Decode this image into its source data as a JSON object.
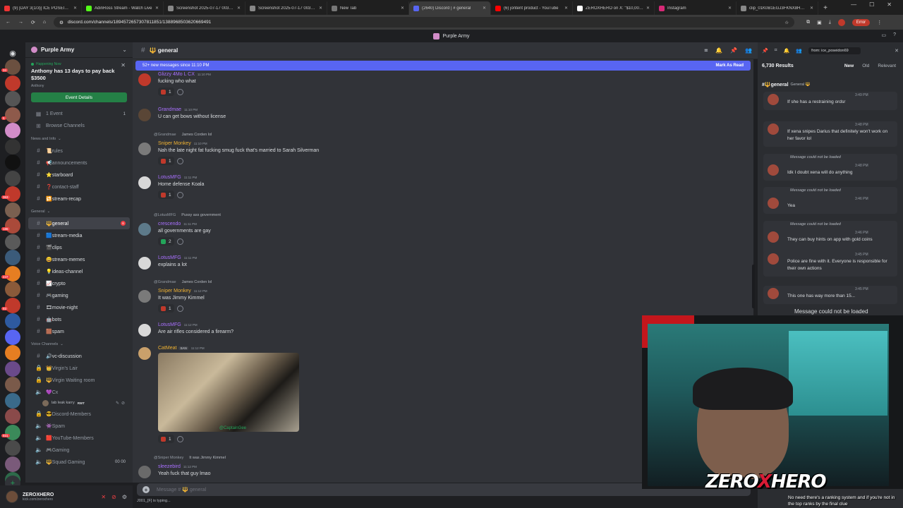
{
  "browser": {
    "tabs": [
      {
        "title": "(9) [DAY 3(1/3)] ICE POSEIDON",
        "color": "#e33"
      },
      {
        "title": "AdinRoss Stream - Watch Live",
        "color": "#53fc18"
      },
      {
        "title": "Screenshot 2025-07-17 003931",
        "color": "#888"
      },
      {
        "title": "Screenshot 2025-07-17 003938",
        "color": "#888"
      },
      {
        "title": "New Tab",
        "color": "#777"
      },
      {
        "title": "(2640) Discord | # general",
        "color": "#5865f2"
      },
      {
        "title": "(6) jontent product - YouTube",
        "color": "#f00"
      },
      {
        "title": "ZEROXHERO on X: \"$10,000 A...",
        "color": "#fff"
      },
      {
        "title": "Instagram",
        "color": "#d62976"
      },
      {
        "title": "clip_01K0B1EGJ3FKNX8HG7V...",
        "color": "#888"
      }
    ],
    "url": "discord.com/channels/1894572657307811851/1388968503620669491",
    "error_label": "Error"
  },
  "window": {
    "title": "Purple Army"
  },
  "server": {
    "name": "Purple Army"
  },
  "event": {
    "status": "Happening Now",
    "title": "Anthony has 13 days to pay back $3500",
    "host": "Anthony",
    "button": "Event Details"
  },
  "guild_badges": [
    "34",
    "",
    "",
    "5",
    "",
    "",
    "",
    "",
    "363",
    "",
    "186",
    "",
    "",
    "247",
    "",
    "93",
    "",
    "",
    "",
    "",
    "",
    "",
    "",
    "931",
    "",
    "",
    "",
    "483"
  ],
  "sidebar": {
    "top": [
      {
        "icon": "calendar",
        "label": "1 Event",
        "count": "1"
      },
      {
        "icon": "browse",
        "label": "Browse Channels",
        "count": ""
      }
    ],
    "categories": [
      {
        "name": "News and Info",
        "channels": [
          {
            "label": "📜rules",
            "type": "text"
          },
          {
            "label": "📢announcements",
            "type": "text"
          },
          {
            "label": "⭐starboard",
            "type": "text",
            "bright": true
          },
          {
            "label": "❓contact-staff",
            "type": "text"
          },
          {
            "label": "🔁stream-recap",
            "type": "text",
            "bright": true
          }
        ]
      },
      {
        "name": "General",
        "channels": [
          {
            "label": "🔱general",
            "type": "text",
            "selected": true,
            "unread": "6"
          },
          {
            "label": "🟦stream-media",
            "type": "text",
            "bright": true
          },
          {
            "label": "🎬clips",
            "type": "text",
            "bright": true
          },
          {
            "label": "😄stream-memes",
            "type": "text",
            "bright": true
          },
          {
            "label": "💡ideas-channel",
            "type": "text",
            "bright": true
          },
          {
            "label": "📈crypto",
            "type": "text",
            "bright": true
          },
          {
            "label": "🎮gaming",
            "type": "text",
            "bright": true
          },
          {
            "label": "🎞movie-night",
            "type": "text",
            "bright": true
          },
          {
            "label": "🤖bots",
            "type": "text",
            "bright": true
          },
          {
            "label": "🟫spam",
            "type": "text",
            "bright": true
          }
        ]
      },
      {
        "name": "Voice Channels",
        "channels": [
          {
            "label": "🔊vc-discussion",
            "type": "text",
            "bright": true
          },
          {
            "label": "👑Virgin's Lair",
            "type": "locked"
          },
          {
            "label": "🔱Virgin Waiting room",
            "type": "locked"
          },
          {
            "label": "💜Cx",
            "type": "voice"
          }
        ]
      }
    ],
    "voice_user": {
      "name": "lab leak karry",
      "badge": "RWT"
    },
    "more": [
      {
        "label": "😎Discord-Members",
        "type": "locked"
      },
      {
        "label": "👾Spam",
        "type": "voice"
      },
      {
        "label": "🟥YouTube-Members",
        "type": "voice"
      },
      {
        "label": "🎮Gaming",
        "type": "voice"
      },
      {
        "label": "🔱Squad Gaming",
        "type": "voice",
        "count": "00  00"
      }
    ]
  },
  "user": {
    "name": "ZEROXHERO",
    "status": "kick.com/zeroxhero"
  },
  "channel": {
    "name": "🔱 general",
    "new_messages": "52+ new messages since 11:10 PM",
    "mark_read": "Mark As Read"
  },
  "messages": [
    {
      "author": "Glizzy 4Mo L CX",
      "author_color": "#a970ff",
      "time": "11:10 PM",
      "text": "fucking who what",
      "reaction": "1",
      "avatar": "#c0392b"
    },
    {
      "author": "Grandmae",
      "author_color": "#a970ff",
      "time": "11:10 PM",
      "text": "U can get bows without license",
      "reaction": "",
      "avatar": "#5a4636"
    },
    {
      "reply_to": "@Grandmae",
      "reply_text": "James Corden lol",
      "author": "Sniper Monkey",
      "author_color": "#f0b232",
      "time": "11:10 PM",
      "text": "Nah the late night fat fucking smug fuck that's married to Sarah Silverman",
      "reaction": "1",
      "avatar": "#7a7a7a"
    },
    {
      "author": "LotusMFG",
      "author_color": "#a970ff",
      "time": "11:11 PM",
      "text": "Home defense Koala",
      "reaction": "1",
      "avatar": "#d8d8d8"
    },
    {
      "reply_to": "@LotusMFG",
      "reply_text": "Pussy ass government",
      "author": "crescendo",
      "author_color": "#a970ff",
      "time": "11:11 PM",
      "text": "all governments are gay",
      "reaction": "2",
      "avatar": "#5d7a8a"
    },
    {
      "author": "LotusMFG",
      "author_color": "#a970ff",
      "time": "11:11 PM",
      "text": "explains a lot",
      "reaction": "",
      "avatar": "#d8d8d8"
    },
    {
      "reply_to": "@Grandmae",
      "reply_text": "James Corden lol",
      "author": "Sniper Monkey",
      "author_color": "#f0b232",
      "time": "11:12 PM",
      "text": "It was Jimmy Kimmel",
      "reaction": "1",
      "avatar": "#7a7a7a"
    },
    {
      "author": "LotusMFG",
      "author_color": "#a970ff",
      "time": "11:12 PM",
      "text": "Are air rifles considered a firearm?",
      "reaction": "",
      "avatar": "#d8d8d8"
    },
    {
      "author": "CatMeat",
      "author_color": "#f0b232",
      "time": "11:12 PM",
      "text": "",
      "badge": "SAN",
      "image_caption": "@CaptainGee",
      "reaction": "1",
      "avatar": "#c9a06b"
    },
    {
      "reply_to": "@Sniper Monkey",
      "reply_text": "It was Jimmy Kimmel",
      "author": "sleezebird",
      "author_color": "#a970ff",
      "time": "11:12 PM",
      "text": "Yeah fuck that guy lmao",
      "reaction": "",
      "avatar": "#6a6a6a"
    }
  ],
  "composer": {
    "placeholder": "Message # 🔱 general",
    "typing": "J001_[F] is typing..."
  },
  "search": {
    "query": "from: ice_poseidon69",
    "results_count": "6,730 Results",
    "sort": [
      "New",
      "Old",
      "Relevant"
    ],
    "group_channel": "#🔱general",
    "group_sub": "General 🔱",
    "not_loaded": "Message could not be loaded",
    "results": [
      {
        "time": "3:49 PM",
        "text": "If she has a restraining ordsr",
        "note": ""
      },
      {
        "time": "3:48 PM",
        "text": "If xena snipes Darius that definitely won't work on her favor lol",
        "note": ""
      },
      {
        "time": "3:48 PM",
        "text": "Idk I doubt xena will do anything",
        "note": "Message could not be loaded"
      },
      {
        "time": "3:46 PM",
        "text": "Yea",
        "note": "Message could not be loaded"
      },
      {
        "time": "3:46 PM",
        "text": "They can buy hints on app with gold coins",
        "note": "Message could not be loaded"
      },
      {
        "time": "3:45 PM",
        "text": "Police are fine with it. Everyone is responsible for their own actions",
        "note": ""
      },
      {
        "time": "3:45 PM",
        "text": "This one has way more than 15...",
        "note": ""
      }
    ]
  },
  "overlay": {
    "logo_left": "ZERO",
    "logo_x": "X",
    "logo_right": "HERO",
    "caption": "No need there's a ranking system and if you're not in the top ranks by the final clue"
  }
}
